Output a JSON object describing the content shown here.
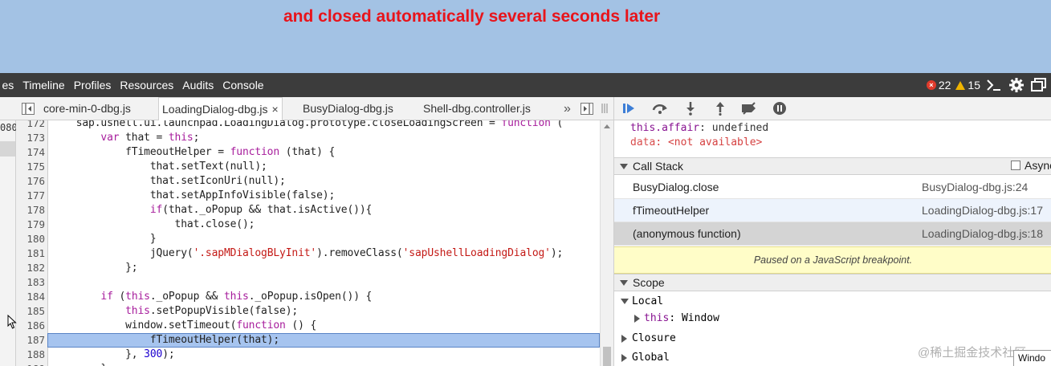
{
  "annotation": {
    "text": "and closed automatically several seconds later"
  },
  "toolbar": {
    "tabs": [
      "es",
      "Timeline",
      "Profiles",
      "Resources",
      "Audits",
      "Console"
    ],
    "errors": "22",
    "warnings": "15"
  },
  "file_tabs": [
    {
      "label": "core-min-0-dbg.js",
      "active": false
    },
    {
      "label": "LoadingDialog-dbg.js",
      "active": true,
      "close": "×"
    },
    {
      "label": "BusyDialog-dbg.js",
      "active": false
    },
    {
      "label": "Shell-dbg.controller.js",
      "active": false
    }
  ],
  "file_tabs_overflow": "»",
  "left_sliver": {
    "line": "080"
  },
  "code": {
    "lines": [
      {
        "n": "172",
        "t": "    sap.ushell.ui.launchpad.LoadingDialog.prototype.closeLoadingScreen = function ("
      },
      {
        "n": "173",
        "t": "        var that = this;"
      },
      {
        "n": "174",
        "t": "            fTimeoutHelper = function (that) {"
      },
      {
        "n": "175",
        "t": "                that.setText(null);"
      },
      {
        "n": "176",
        "t": "                that.setIconUri(null);"
      },
      {
        "n": "177",
        "t": "                that.setAppInfoVisible(false);"
      },
      {
        "n": "178",
        "t": "                if(that._oPopup && that.isActive()){"
      },
      {
        "n": "179",
        "t": "                    that.close();"
      },
      {
        "n": "180",
        "t": "                }"
      },
      {
        "n": "181",
        "t": "                jQuery('.sapMDialogBLyInit').removeClass('sapUshellLoadingDialog');"
      },
      {
        "n": "182",
        "t": "            };"
      },
      {
        "n": "183",
        "t": ""
      },
      {
        "n": "184",
        "t": "        if (this._oPopup && this._oPopup.isOpen()) {"
      },
      {
        "n": "185",
        "t": "            this.setPopupVisible(false);"
      },
      {
        "n": "186",
        "t": "            window.setTimeout(function () {"
      },
      {
        "n": "187",
        "t": "                fTimeoutHelper(that);"
      },
      {
        "n": "188",
        "t": "            }, 300);"
      },
      {
        "n": "189",
        "t": "        }"
      }
    ],
    "highlighted_line": "187"
  },
  "watch": {
    "item1_name": "this.affair",
    "item1_value": "undefined",
    "item2_name": "data",
    "item2_value": "<not available>"
  },
  "call_stack": {
    "title": "Call Stack",
    "async_label": "Async",
    "frames": [
      {
        "fn": "BusyDialog.close",
        "loc": "BusyDialog-dbg.js:24"
      },
      {
        "fn": "fTimeoutHelper",
        "loc": "LoadingDialog-dbg.js:17"
      },
      {
        "fn": "(anonymous function)",
        "loc": "LoadingDialog-dbg.js:18"
      }
    ]
  },
  "paused_message": "Paused on a JavaScript breakpoint.",
  "scope": {
    "title": "Scope",
    "local": "Local",
    "local_this_name": "this",
    "local_this_value": "Window",
    "closure": "Closure",
    "global": "Global",
    "global_value": "Windo"
  },
  "watermark": "@稀土掘金技术社区",
  "colors": {
    "banner": "#a3c2e4",
    "annotation": "#e8141b",
    "toolbar": "#3c3c3c",
    "highlight": "#a6c4ef",
    "paused_bg": "#fffdc8"
  }
}
